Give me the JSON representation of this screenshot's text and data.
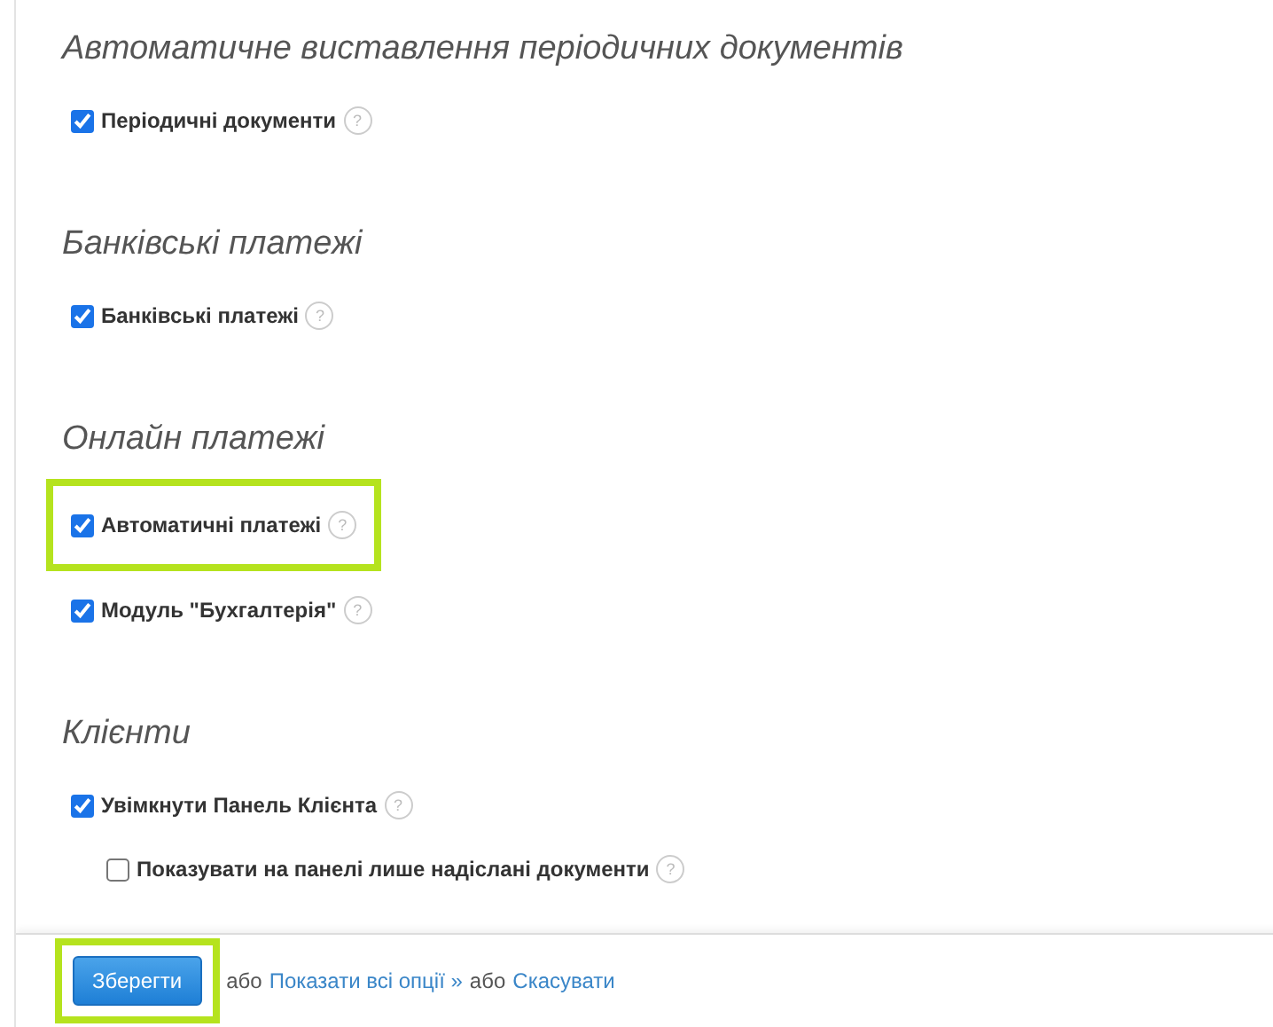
{
  "help_mark": "?",
  "sections": [
    {
      "title": "Автоматичне виставлення періодичних документів",
      "options": [
        {
          "label": "Періодичні документи",
          "checked": true
        }
      ]
    },
    {
      "title": "Банківські платежі",
      "options": [
        {
          "label": "Банківські платежі",
          "checked": true
        }
      ]
    },
    {
      "title": "Онлайн платежі",
      "options": [
        {
          "label": "Автоматичні платежі",
          "checked": true,
          "highlighted": true
        },
        {
          "label": "Модуль \"Бухгалтерія\"",
          "checked": true
        }
      ]
    },
    {
      "title": "Клієнти",
      "options": [
        {
          "label": "Увімкнути Панель Клієнта",
          "checked": true,
          "children": [
            {
              "label": "Показувати на панелі лише надіслані документи",
              "checked": false
            }
          ]
        }
      ]
    }
  ],
  "footer": {
    "save_button": {
      "label": "Зберегти",
      "highlighted": true
    },
    "or_1": "або",
    "show_all_link": "Показати всі опції »",
    "or_2": "або",
    "cancel_link": "Скасувати"
  }
}
